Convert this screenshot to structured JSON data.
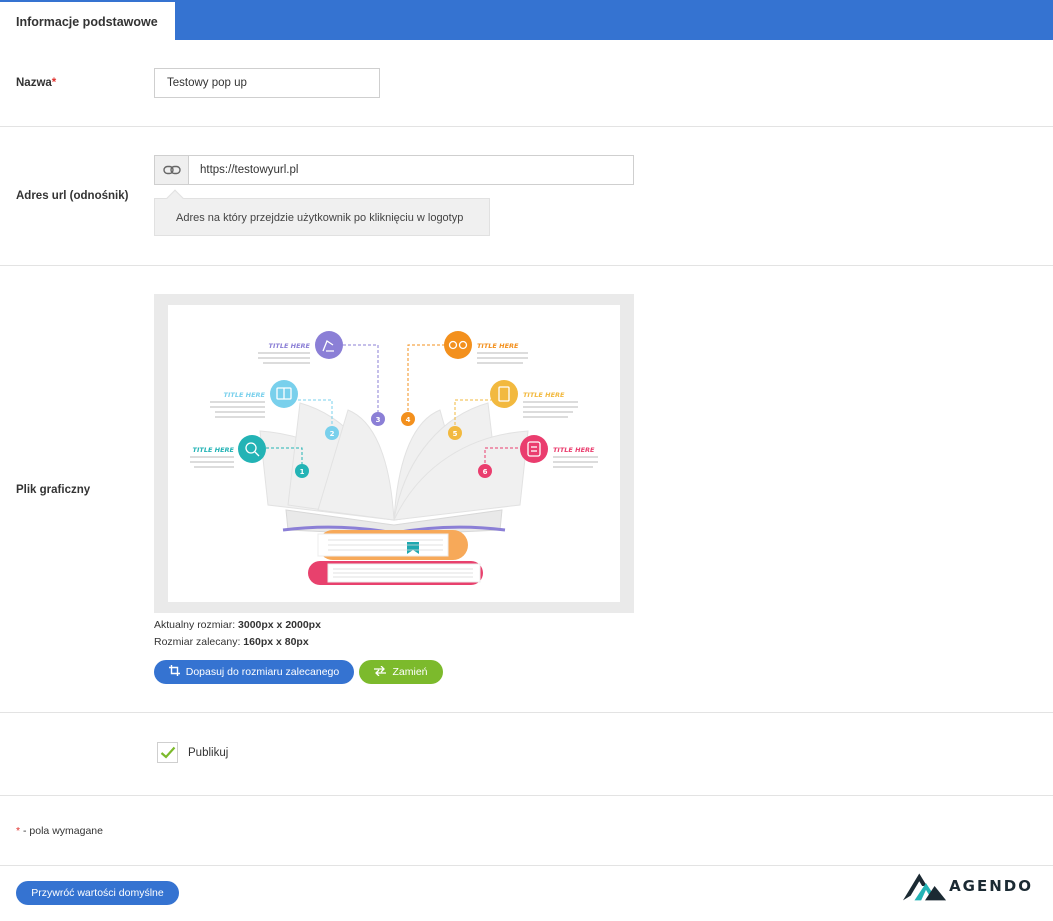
{
  "tabs": {
    "active": "Informacje podstawowe"
  },
  "fields": {
    "name": {
      "label": "Nazwa",
      "required_mark": "*",
      "value": "Testowy pop up"
    },
    "url": {
      "label": "Adres url (odnośnik)",
      "value": "https://testowyurl.pl",
      "hint": "Adres na który przejdzie użytkownik po kliknięciu w logotyp",
      "addon_icon": "link-icon"
    },
    "image": {
      "label": "Plik graficzny",
      "current_size_label": "Aktualny rozmiar:",
      "current_size_value": "3000px x 2000px",
      "recommended_size_label": "Rozmiar zalecany:",
      "recommended_size_value": "160px x 80px",
      "fit_button": "Dopasuj do rozmiaru zalecanego",
      "replace_button": "Zamień",
      "preview": {
        "title_text": "TITLE HERE",
        "numbers": [
          "1",
          "2",
          "3",
          "4",
          "5",
          "6"
        ]
      }
    },
    "publish": {
      "label": "Publikuj",
      "checked": true
    }
  },
  "required_note": {
    "mark": "*",
    "text": " - pola wymagane"
  },
  "footer": {
    "reset_button": "Przywróć wartości domyślne",
    "logo_text": "AGENDO"
  },
  "colors": {
    "primary": "#3573d1",
    "success": "#7cba2c",
    "required": "#e0332f",
    "infographic": [
      "#8b7fd6",
      "#79d0ec",
      "#23b3b5",
      "#f3901d",
      "#f2b93f",
      "#ea3d6e"
    ]
  }
}
